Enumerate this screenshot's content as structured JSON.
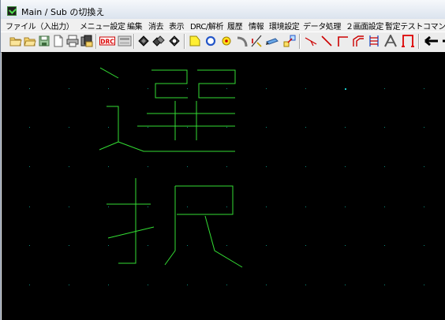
{
  "window": {
    "title": "Main / Sub の切換え"
  },
  "menu": [
    "ファイル（入出力）",
    "メニュー設定",
    "編集",
    "消去",
    "表示",
    "DRC/解析",
    "履歴",
    "情報",
    "環境設定",
    "データ処理",
    "２画面設定",
    "暫定テストコマンド"
  ],
  "toolbar": {
    "drc_label": "DRC"
  },
  "toolbar_icons": [
    "open-folder-icon",
    "open-folder-icon",
    "save-icon",
    "new-page-icon",
    "print-icon",
    "drc-icon",
    "layer-icon",
    "move-icon",
    "copy-icon",
    "rotate-icon",
    "polygon-icon",
    "circle-icon",
    "point-icon",
    "arc-icon",
    "slant-line-icon",
    "pencil-icon",
    "connect-icon",
    "line-icon",
    "line-diagonal-icon",
    "corner-line-icon",
    "corner-line-double-icon",
    "bus-icon",
    "text-icon",
    "bracket-icon",
    "arrow-left-icon"
  ],
  "colors": {
    "drawing": "#33dd33",
    "canvas": "#000000",
    "grid_dot": "#0a8a7a",
    "accent_dot": "#18c8c8"
  }
}
